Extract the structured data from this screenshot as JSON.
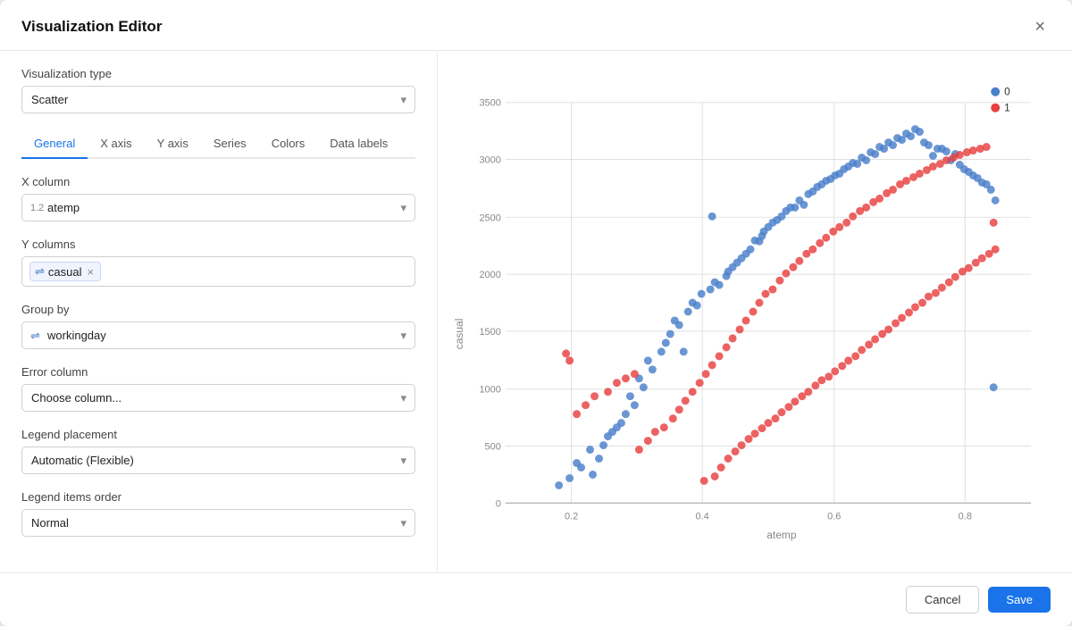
{
  "dialog": {
    "title": "Visualization Editor",
    "close_label": "×"
  },
  "visualization": {
    "type_label": "Visualization type",
    "type_value": "Scatter",
    "type_icon": "scatter-icon"
  },
  "tabs": [
    {
      "label": "General",
      "active": true
    },
    {
      "label": "X axis",
      "active": false
    },
    {
      "label": "Y axis",
      "active": false
    },
    {
      "label": "Series",
      "active": false
    },
    {
      "label": "Colors",
      "active": false
    },
    {
      "label": "Data labels",
      "active": false
    }
  ],
  "general": {
    "x_column_label": "X column",
    "x_column_value": "atemp",
    "y_columns_label": "Y columns",
    "y_column_tag": "casual",
    "group_by_label": "Group by",
    "group_by_value": "workingday",
    "error_column_label": "Error column",
    "error_column_placeholder": "Choose column...",
    "legend_placement_label": "Legend placement",
    "legend_placement_value": "Automatic (Flexible)",
    "legend_order_label": "Legend items order",
    "legend_order_value": "Normal"
  },
  "footer": {
    "cancel_label": "Cancel",
    "save_label": "Save"
  },
  "chart": {
    "x_axis_label": "atemp",
    "y_axis_label": "casual",
    "legend": [
      {
        "label": "0",
        "color": "#4a7fcb"
      },
      {
        "label": "1",
        "color": "#e84040"
      }
    ],
    "x_ticks": [
      "0.2",
      "0.4",
      "0.6",
      "0.8"
    ],
    "y_ticks": [
      "0",
      "500",
      "1000",
      "1500",
      "2000",
      "2500",
      "3000",
      "3500"
    ]
  }
}
